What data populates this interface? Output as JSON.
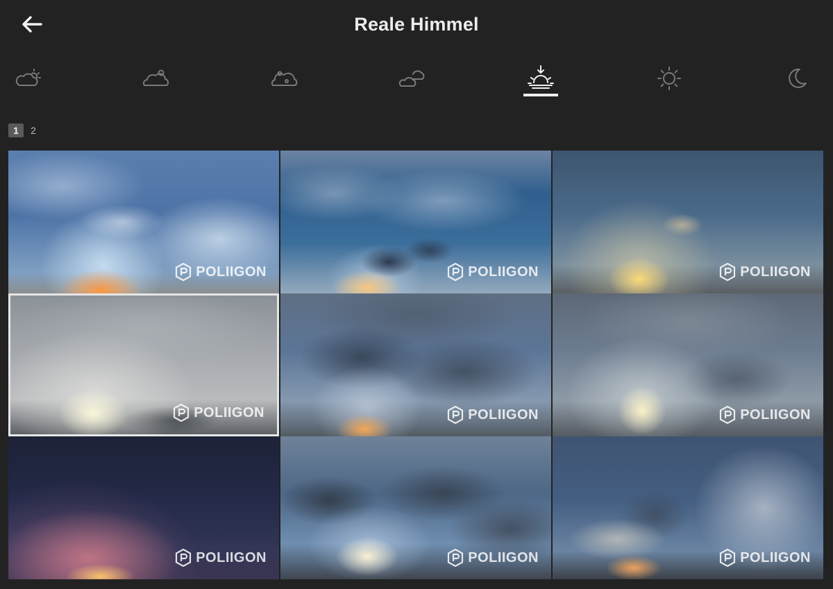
{
  "header": {
    "title": "Reale Himmel",
    "back_icon": "arrow-left-icon"
  },
  "filters": [
    {
      "icon": "partly-cloudy-icon",
      "active": false
    },
    {
      "icon": "cloudy-sun-icon",
      "active": false
    },
    {
      "icon": "overcast-icon",
      "active": false
    },
    {
      "icon": "clouds-icon",
      "active": false
    },
    {
      "icon": "sunset-icon",
      "active": true
    },
    {
      "icon": "sun-icon",
      "active": false
    },
    {
      "icon": "moon-icon",
      "active": false
    }
  ],
  "pagination": {
    "pages": [
      "1",
      "2"
    ],
    "current": "1"
  },
  "tiles": [
    {
      "watermark": "POLIIGON",
      "selected": false
    },
    {
      "watermark": "POLIIGON",
      "selected": false
    },
    {
      "watermark": "POLIIGON",
      "selected": false
    },
    {
      "watermark": "POLIIGON",
      "selected": true
    },
    {
      "watermark": "POLIIGON",
      "selected": false
    },
    {
      "watermark": "POLIIGON",
      "selected": false
    },
    {
      "watermark": "POLIIGON",
      "selected": false
    },
    {
      "watermark": "POLIIGON",
      "selected": false
    },
    {
      "watermark": "POLIIGON",
      "selected": false
    }
  ],
  "colors": {
    "background": "#222223",
    "active_icon": "#f0f0f0",
    "inactive_icon": "#7a7a7a",
    "selected_border": "#e6e6e6"
  }
}
